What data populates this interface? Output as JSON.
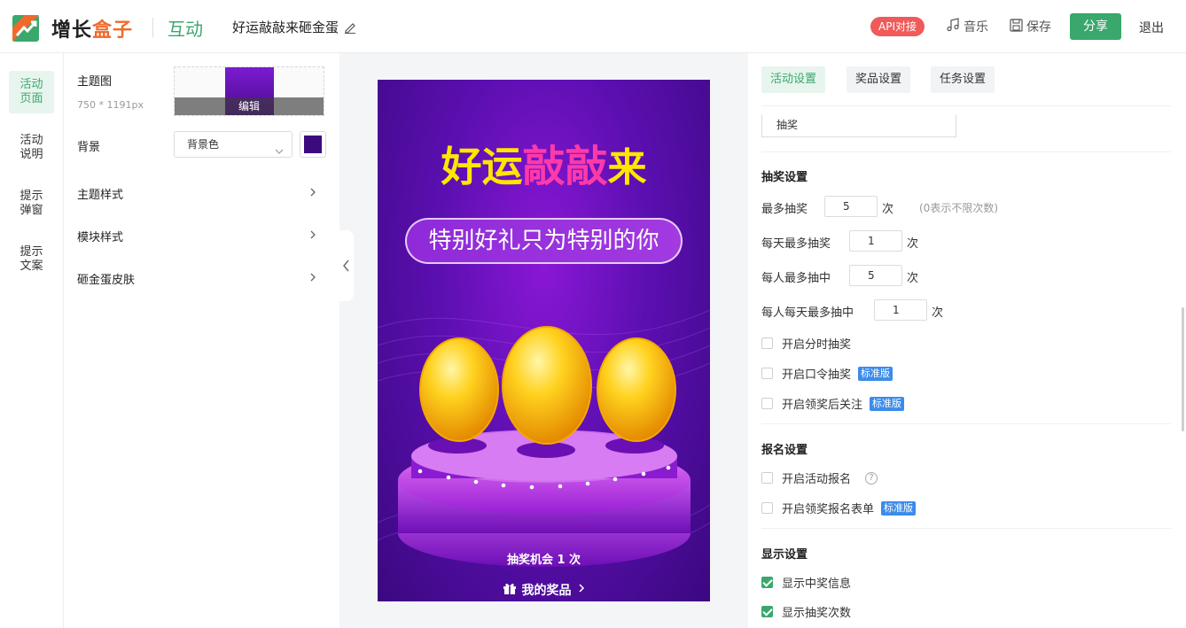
{
  "header": {
    "logo_text_a": "增长",
    "logo_text_b": "盒子",
    "brand_sub": "互动",
    "doc_title": "好运敲敲来砸金蛋",
    "api_badge": "API对接",
    "music_label": "音乐",
    "save_label": "保存",
    "share_label": "分享",
    "exit_label": "退出"
  },
  "leftnav": {
    "items": [
      {
        "label_1": "活动",
        "label_2": "页面"
      },
      {
        "label_1": "活动",
        "label_2": "说明"
      },
      {
        "label_1": "提示",
        "label_2": "弹窗"
      },
      {
        "label_1": "提示",
        "label_2": "文案"
      }
    ]
  },
  "settings": {
    "theme_image_label": "主题图",
    "theme_image_size": "750 * 1191px",
    "edit_label": "编辑",
    "background_label": "背景",
    "background_select": "背景色",
    "background_color": "#3b0a7e",
    "rows": [
      "主题样式",
      "模块样式",
      "砸金蛋皮肤"
    ]
  },
  "preview": {
    "title_a": "好运",
    "title_b": "敲敲",
    "title_c": "来",
    "subtitle": "特别好礼只为特别的你",
    "chances": "抽奖机会 1 次",
    "my_prize": "我的奖品"
  },
  "right": {
    "tabs": [
      "活动设置",
      "奖品设置",
      "任务设置"
    ],
    "name_value": "抽奖",
    "lottery_title": "抽奖设置",
    "max_draw_label": "最多抽奖",
    "max_draw_value": "5",
    "max_draw_unit": "次",
    "max_draw_hint": "(0表示不限次数)",
    "daily_max_label": "每天最多抽奖",
    "daily_max_value": "1",
    "daily_max_unit": "次",
    "person_max_label": "每人最多抽中",
    "person_max_value": "5",
    "person_max_unit": "次",
    "person_daily_label": "每人每天最多抽中",
    "person_daily_value": "1",
    "person_daily_unit": "次",
    "timed_draw": "开启分时抽奖",
    "password_draw": "开启口令抽奖",
    "follow_after": "开启领奖后关注",
    "std_badge": "标准版",
    "signup_title": "报名设置",
    "signup_enable": "开启活动报名",
    "signup_form": "开启领奖报名表单",
    "display_title": "显示设置",
    "show_winner": "显示中奖信息",
    "show_count": "显示抽奖次数"
  }
}
